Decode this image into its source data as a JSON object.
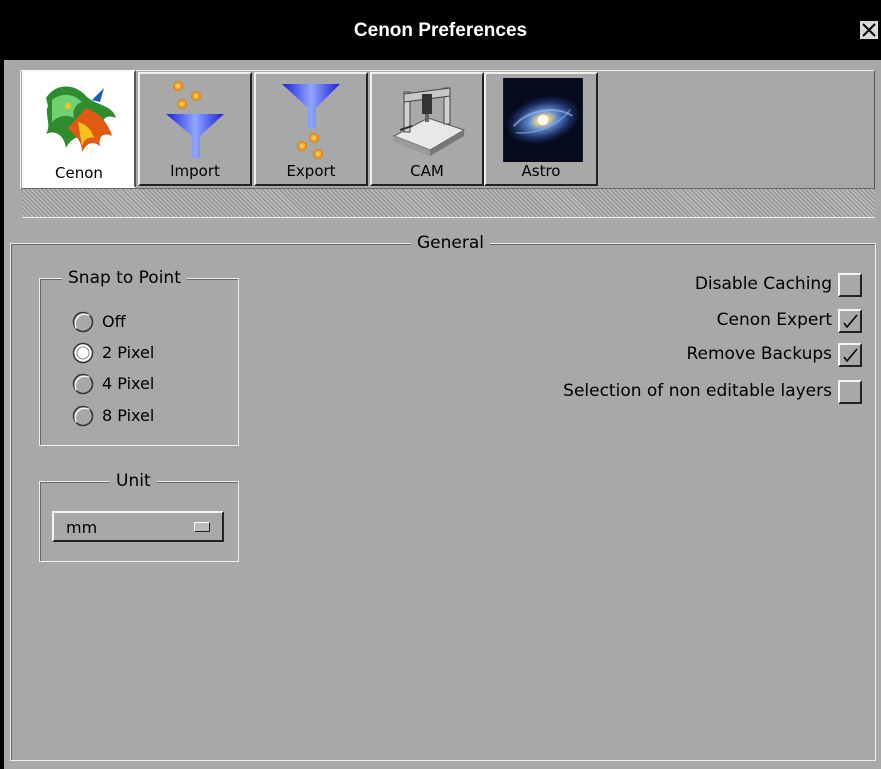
{
  "window": {
    "title": "Cenon Preferences"
  },
  "tabs": [
    {
      "label": "Cenon",
      "icon": "dragon-icon",
      "selected": true
    },
    {
      "label": "Import",
      "icon": "funnel-import-icon",
      "selected": false
    },
    {
      "label": "Export",
      "icon": "funnel-export-icon",
      "selected": false
    },
    {
      "label": "CAM",
      "icon": "cnc-machine-icon",
      "selected": false
    },
    {
      "label": "Astro",
      "icon": "galaxy-icon",
      "selected": false
    }
  ],
  "general": {
    "title": "General",
    "snap_to_point": {
      "title": "Snap to Point",
      "options": [
        "Off",
        "2 Pixel",
        "4 Pixel",
        "8 Pixel"
      ],
      "selected": "2 Pixel"
    },
    "unit": {
      "title": "Unit",
      "value": "mm"
    },
    "options": [
      {
        "label": "Disable Caching",
        "checked": false
      },
      {
        "label": "Cenon Expert",
        "checked": true
      },
      {
        "label": "Remove Backups",
        "checked": true
      },
      {
        "label": "Selection of non editable layers",
        "checked": false
      }
    ]
  },
  "colors": {
    "background": "#a8a8a8",
    "titlebar": "#000000"
  }
}
